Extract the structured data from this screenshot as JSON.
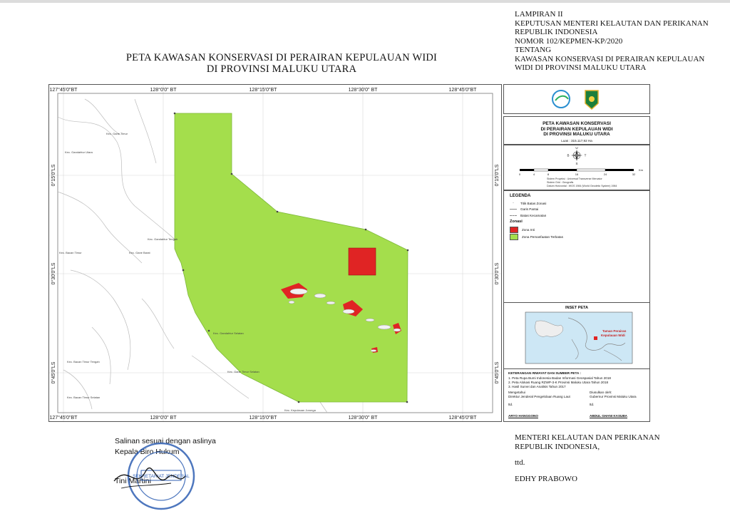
{
  "header": {
    "lampiran": "LAMPIRAN II",
    "line1": "KEPUTUSAN MENTERI KELAUTAN DAN PERIKANAN",
    "line2": "REPUBLIK INDONESIA",
    "line3": "NOMOR 102/KEPMEN-KP/2020",
    "line4": "TENTANG",
    "line5": "KAWASAN KONSERVASI DI PERAIRAN KEPULAUAN",
    "line6": "WIDI DI PROVINSI MALUKU UTARA"
  },
  "title": {
    "line1": "PETA KAWASAN KONSERVASI DI PERAIRAN KEPULAUAN WIDI",
    "line2": "DI PROVINSI MALUKU UTARA"
  },
  "map": {
    "lon_labels": [
      "127°45'0\"BT",
      "128°0'0\" BT",
      "128°15'0\"BT",
      "128°30'0\" BT",
      "128°45'0\"BT"
    ],
    "lat_labels": [
      "0°15'0\"LS",
      "0°30'0\"LS",
      "0°45'0\"LS"
    ],
    "place_labels": {
      "gane_timur": "Kec. Gane Timur",
      "gane_utara": "Kec. Gandahtur Utara",
      "gane_tengah": "Kec. Gandahtur Tengah",
      "gane_barat": "Kec. Gane Barat",
      "bacan_timur": "Kec. Bacan Timur",
      "gane_selatan": "Kec. Gandahtur Selatan",
      "barat_gane_selatan": "Kec. Gane Timur Selatan",
      "bacan_tengah": "Kec. Bacan Timur Tengah",
      "bacan_selatan": "Kec. Bacan Timur Selatan",
      "kepulauan_joronga": "Kec. Kepulauan Joronga"
    },
    "colors": {
      "zona_inti": "#e02424",
      "zona_pemanfaatan": "#a4de4c",
      "land_lines": "#b9b9b9"
    }
  },
  "side": {
    "title_line1": "PETA KAWASAN KONSERVASI",
    "title_line2": "DI PERAIRAN KEPULAUAN WIDI",
    "title_line3": "DI PROVINSI MALUKU UTARA",
    "luas": "Luas : 315.117,92 Ha",
    "compass": {
      "n": "U",
      "s": "S",
      "e": "T",
      "w": "B"
    },
    "scale_ticks": [
      "0",
      "4",
      "8",
      "16",
      "24",
      "32"
    ],
    "scale_unit": "Km",
    "proj_line1": "Sistem Proyeksi : Universal Transverse Mercator",
    "proj_line2": "Sistem Grid : Geografis",
    "proj_line3": "Datum Horizontal : WGS 1984 (World Geodetic System) 1984",
    "legenda_title": "LEGENDA",
    "legend_items": [
      "Titik Batas Zonasi",
      "Garis Pantai",
      "Batas Kecamatan"
    ],
    "zonasi_title": "Zonasi",
    "zonasi_items": [
      "Zona Inti",
      "Zona Pemanfaatan Terbatas"
    ],
    "inset_title": "INSET PETA",
    "inset_label_line1": "Taman Perairan",
    "inset_label_line2": "Kepulauan Widi",
    "info_title": "KETERANGAN RIWAYAT DAN SUMBER PETA :",
    "info_items": [
      "1. Peta Rupa Bumi Indonesia Badan Informasi Geospasial Tahun 2018",
      "2. Peta Alokasi Ruang RZWP-3-K Provinsi Maluku Utara Tahun 2018",
      "3. Hasil Survei dan Analisis Tahun 2017"
    ],
    "mengetahui": "Mengetahui",
    "direktur": "Direktur Jenderal Pengelolaan Ruang Laut",
    "diusulkan": "Diusulkan oleh:",
    "gubernur": "Gubernur Provinsi Maluku Utara",
    "ttd_left": "ttd.",
    "ttd_right": "ttd.",
    "name_left": "ARYO HANGGONO",
    "name_right": "ABDUL GHANI KASUBA"
  },
  "signature_left": {
    "line1": "Salinan sesuai dengan aslinya",
    "line2": "Kepala Biro Hukum",
    "name": "Tini Martini",
    "stamp_text": "SEKRETARIAT JENDERAL"
  },
  "signature_right": {
    "line1": "MENTERI KELAUTAN DAN PERIKANAN",
    "line2": "REPUBLIK INDONESIA,",
    "ttd": "ttd.",
    "name": "EDHY PRABOWO"
  }
}
